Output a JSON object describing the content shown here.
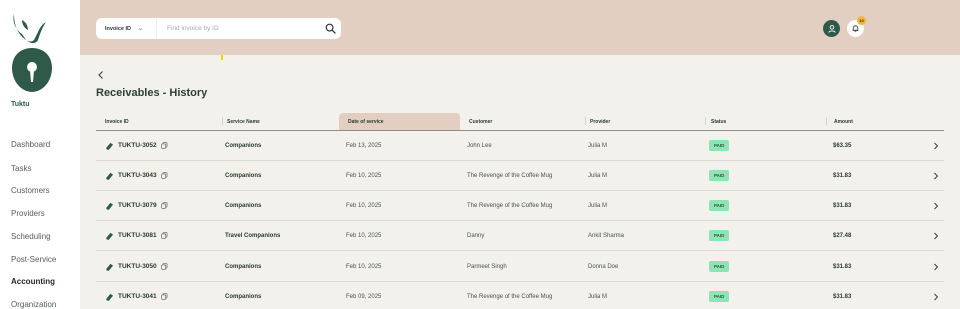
{
  "brand": {
    "name": "Tuktu"
  },
  "sidebar": {
    "items": [
      {
        "label": "Dashboard",
        "active": false
      },
      {
        "label": "Tasks",
        "active": false
      },
      {
        "label": "Customers",
        "active": false
      },
      {
        "label": "Providers",
        "active": false
      },
      {
        "label": "Scheduling",
        "active": false
      },
      {
        "label": "Post-Service",
        "active": false
      },
      {
        "label": "Accounting",
        "active": true
      },
      {
        "label": "Organization",
        "active": false
      }
    ]
  },
  "header": {
    "search": {
      "select_label": "Invoice ID",
      "placeholder": "Find invoice by ID",
      "value": ""
    },
    "notifications": {
      "count": "10"
    }
  },
  "page": {
    "title": "Receivables - History"
  },
  "table": {
    "columns": [
      "Invoice ID",
      "Service Name",
      "Date of service",
      "Customer",
      "Provider",
      "Status",
      "Amount"
    ],
    "sorted_column": "Date of service",
    "rows": [
      {
        "invoice_id": "TUKTU-3052",
        "service": "Companions",
        "date": "Feb 13, 2025",
        "customer": "John Lee",
        "provider": "Julia M",
        "status": "PAID",
        "amount": "$63.35"
      },
      {
        "invoice_id": "TUKTU-3043",
        "service": "Companions",
        "date": "Feb 10, 2025",
        "customer": "The Revenge of the Coffee Mug",
        "provider": "Julia M",
        "status": "PAID",
        "amount": "$31.83"
      },
      {
        "invoice_id": "TUKTU-3079",
        "service": "Companions",
        "date": "Feb 10, 2025",
        "customer": "The Revenge of the Coffee Mug",
        "provider": "Julia M",
        "status": "PAID",
        "amount": "$31.83"
      },
      {
        "invoice_id": "TUKTU-3081",
        "service": "Travel Companions",
        "date": "Feb 10, 2025",
        "customer": "Danny",
        "provider": "Ankit Sharma",
        "status": "PAID",
        "amount": "$27.48"
      },
      {
        "invoice_id": "TUKTU-3050",
        "service": "Companions",
        "date": "Feb 10, 2025",
        "customer": "Parmeet Singh",
        "provider": "Donna Doe",
        "status": "PAID",
        "amount": "$31.83"
      },
      {
        "invoice_id": "TUKTU-3041",
        "service": "Companions",
        "date": "Feb 09, 2025",
        "customer": "The Revenge of the Coffee Mug",
        "provider": "Julia M",
        "status": "PAID",
        "amount": "$31.83"
      }
    ]
  },
  "colors": {
    "brand_green": "#2f5a4a",
    "header_bg": "#e2cfc1",
    "page_bg": "#f2f1ec",
    "paid_badge": "#8fe3b4",
    "notification_badge": "#f2b43c"
  },
  "icons": {
    "back": "chevron-left-icon",
    "search": "search-icon",
    "dropdown": "chevron-down-icon",
    "avatar": "user-icon",
    "bell": "bell-icon",
    "invoice": "document-icon",
    "copy": "copy-icon",
    "row_open": "chevron-right-icon"
  }
}
